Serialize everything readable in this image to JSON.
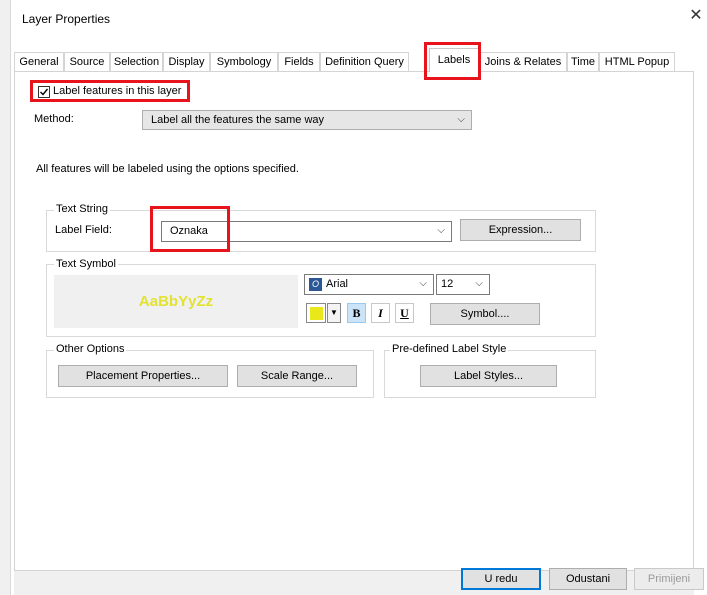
{
  "window": {
    "title": "Layer Properties",
    "close_glyph": "✕"
  },
  "tabs": [
    {
      "label": "General"
    },
    {
      "label": "Source"
    },
    {
      "label": "Selection"
    },
    {
      "label": "Display"
    },
    {
      "label": "Symbology"
    },
    {
      "label": "Fields"
    },
    {
      "label": "Definition Query"
    },
    {
      "label": "Labels"
    },
    {
      "label": "Joins & Relates"
    },
    {
      "label": "Time"
    },
    {
      "label": "HTML Popup"
    }
  ],
  "active_tab": "Labels",
  "label_features": {
    "label": "Label features in this layer",
    "checked": true
  },
  "method": {
    "label": "Method:",
    "value": "Label all the features the same way"
  },
  "info_text": "All features will be labeled using the options specified.",
  "text_string": {
    "legend": "Text String",
    "field_label": "Label Field:",
    "field_value": "Oznaka",
    "expression_button": "Expression..."
  },
  "text_symbol": {
    "legend": "Text Symbol",
    "preview_text": "AaBbYyZz",
    "font_value": "Arial",
    "size_value": "12",
    "bold_label": "B",
    "italic_label": "I",
    "underline_label": "U",
    "symbol_button": "Symbol....",
    "color": "#e8e81a"
  },
  "other_options": {
    "legend": "Other Options",
    "placement_button": "Placement Properties...",
    "scale_button": "Scale Range..."
  },
  "predefined": {
    "legend": "Pre-defined Label Style",
    "styles_button": "Label Styles..."
  },
  "footer": {
    "ok": "U redu",
    "cancel": "Odustani",
    "apply": "Primijeni"
  },
  "colors": {
    "highlight": "#e8141c",
    "accent": "#0078d7"
  }
}
